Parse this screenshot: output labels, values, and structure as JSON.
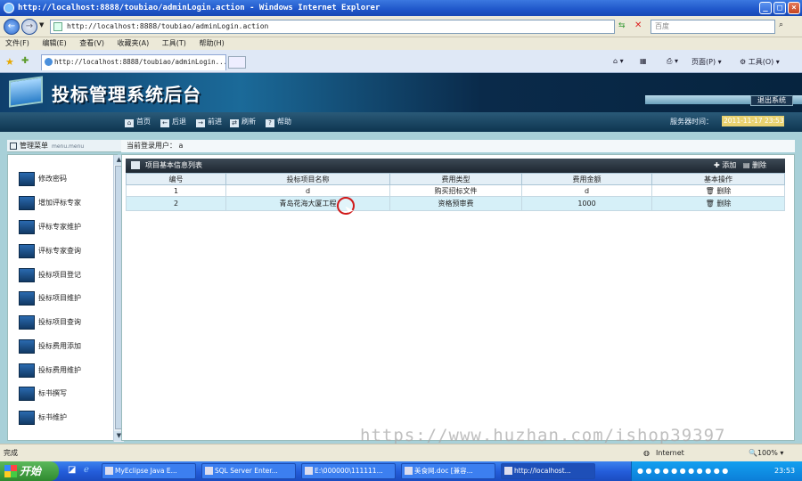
{
  "browser": {
    "window_title": "http://localhost:8888/toubiao/adminLogin.action - Windows Internet Explorer",
    "address": "http://localhost:8888/toubiao/adminLogin.action",
    "search_placeholder": "百度",
    "menu": [
      "文件(F)",
      "编辑(E)",
      "查看(V)",
      "收藏夹(A)",
      "工具(T)",
      "帮助(H)"
    ],
    "tab_title": "http://localhost:8888/toubiao/adminLogin...",
    "page_label": "页面(P)",
    "tools_label": "工具(O)",
    "status_left": "完成",
    "status_zone": "Internet",
    "zoom": "100%"
  },
  "header": {
    "title": "投标管理系统后台",
    "logout": "退出系统"
  },
  "nav": {
    "items": [
      "首页",
      "后退",
      "前进",
      "刷新",
      "帮助"
    ],
    "server_time_label": "服务器时间：",
    "server_time": "2011-11-17 23:53"
  },
  "sidebar": {
    "title": "管理菜单",
    "title_small": "menu.menu",
    "items": [
      "修改密码",
      "增加评标专家",
      "评标专家维护",
      "评标专家查询",
      "投标项目登记",
      "投标项目维护",
      "投标项目查询",
      "投标费用添加",
      "投标费用维护",
      "标书撰写",
      "标书维护"
    ]
  },
  "main": {
    "current_user_label": "当前登录用户：",
    "current_user": "a",
    "list_title": "项目基本信息列表",
    "add": "添加",
    "delete": "删除",
    "columns": [
      "编号",
      "投标项目名称",
      "费用类型",
      "费用金额",
      "基本操作"
    ],
    "rows": [
      {
        "id": "1",
        "name": "d",
        "type": "购买招标文件",
        "amount": "d",
        "op": "删除"
      },
      {
        "id": "2",
        "name": "青岛花海大厦工程",
        "type": "资格预审费",
        "amount": "1000",
        "op": "删除"
      }
    ]
  },
  "watermark": "https://www.huzhan.com/ishop39397",
  "taskbar": {
    "start": "开始",
    "tasks": [
      "MyEclipse Java E...",
      "SQL Server Enter...",
      "E:\\000000\\111111...",
      "美食网.doc [兼容...",
      "http://localhost..."
    ],
    "clock": "23:53"
  }
}
